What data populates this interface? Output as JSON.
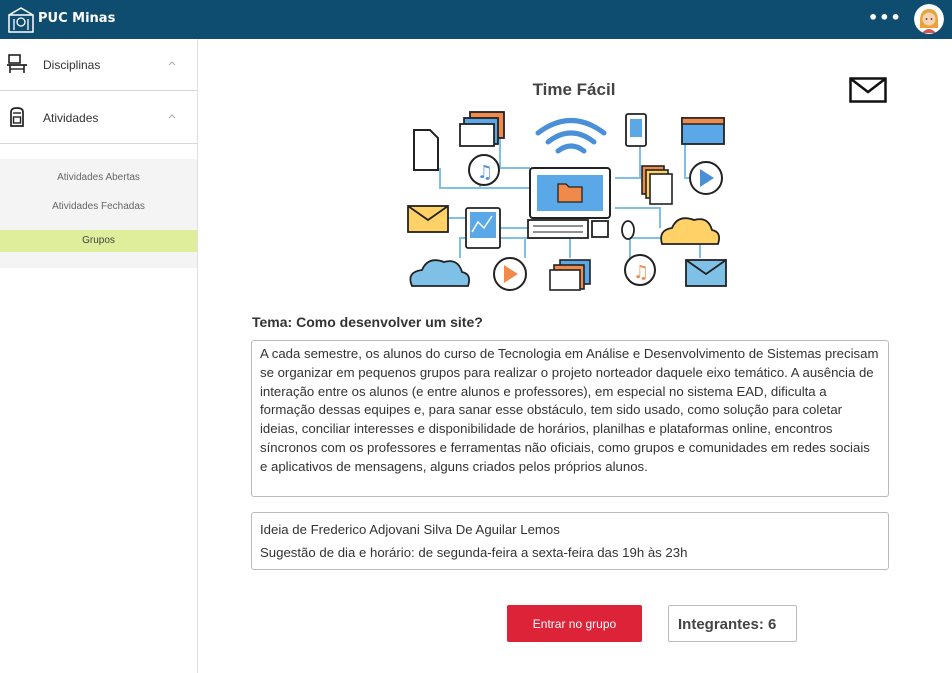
{
  "header": {
    "brand": "PUC Minas",
    "more_label": "•••",
    "logo_icon": "puc-minas-crest-icon",
    "avatar_icon": "user-avatar-icon",
    "bg_color": "#0e4d70"
  },
  "sidebar": {
    "items": [
      {
        "label": "Disciplinas",
        "icon": "desk-chair-icon"
      },
      {
        "label": "Atividades",
        "icon": "backpack-icon"
      }
    ],
    "subitems": [
      {
        "label": "Atividades Abertas",
        "active": false
      },
      {
        "label": "Atividades Fechadas",
        "active": false
      },
      {
        "label": "Grupos",
        "active": true
      }
    ],
    "active_color": "#dfee9b"
  },
  "main": {
    "title": "Time Fácil",
    "mail_icon": "envelope-icon",
    "tema": "Tema: Como desenvolver um site?",
    "description": "A cada semestre, os alunos do curso de Tecnologia em Análise e Desenvolvimento de Sistemas precisam se organizar em pequenos grupos para realizar o projeto norteador daquele eixo temático. A ausência de interação entre os alunos (e entre alunos e professores), em especial no sistema EAD, dificulta a formação dessas equipes e, para sanar esse obstáculo, tem sido usado, como solução para coletar ideias, conciliar interesses e disponibilidade de horários, planilhas e plataformas online, encontros síncronos com os professores e ferramentas não oficiais, como grupos e comunidades em redes sociais e aplicativos de mensagens, alguns criados pelos próprios alunos.",
    "idea_author": "Ideia de Frederico Adjovani Silva De Aguilar Lemos",
    "idea_schedule": "Sugestão de dia e horário: de segunda-feira a sexta-feira das 19h às 23h",
    "join_button": "Entrar no grupo",
    "join_color": "#dc2338",
    "members": "Integrantes: 6"
  }
}
